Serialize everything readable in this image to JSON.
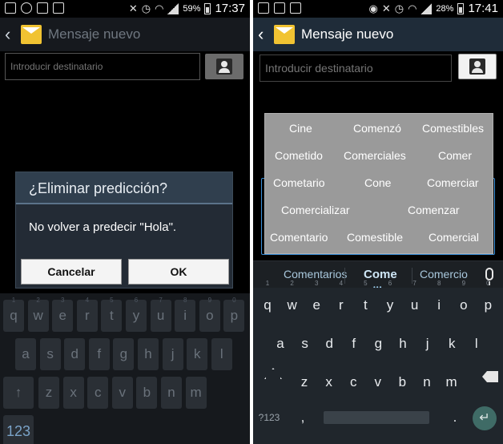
{
  "left": {
    "status": {
      "battery": "59%",
      "time": "17:37"
    },
    "header": {
      "title": "Mensaje nuevo"
    },
    "recipient": {
      "placeholder": "Introducir destinatario"
    },
    "dialog": {
      "title": "¿Eliminar predicción?",
      "message": "No volver a predecir \"Hola\".",
      "cancel_label": "Cancelar",
      "ok_label": "OK"
    },
    "keyboard": {
      "row1": [
        "q",
        "w",
        "e",
        "r",
        "t",
        "y",
        "u",
        "i",
        "o",
        "p"
      ],
      "row1_sub": [
        "1",
        "2",
        "3",
        "4",
        "5",
        "6",
        "7",
        "8",
        "9",
        "0"
      ],
      "row2": [
        "a",
        "s",
        "d",
        "f",
        "g",
        "h",
        "j",
        "k",
        "l"
      ],
      "row3": [
        "z",
        "x",
        "c",
        "v",
        "b",
        "n",
        "m"
      ],
      "symbols_label": "123"
    }
  },
  "right": {
    "status": {
      "battery": "28%",
      "time": "17:41"
    },
    "header": {
      "title": "Mensaje nuevo"
    },
    "recipient": {
      "placeholder": "Introducir destinatario"
    },
    "suggestions": [
      "Cine",
      "Comenzó",
      "Comestibles",
      "Cometido",
      "Comerciales",
      "Comer",
      "Cometario",
      "Cone",
      "Comerciar",
      "Comercializar",
      "Comenzar",
      "Comentario",
      "Comestible",
      "Comercial"
    ],
    "strip": [
      "Comentarios",
      "Come",
      "Comercio"
    ],
    "keyboard": {
      "row1": [
        "q",
        "w",
        "e",
        "r",
        "t",
        "y",
        "u",
        "i",
        "o",
        "p"
      ],
      "row1_sub": [
        "1",
        "2",
        "3",
        "4",
        "5",
        "6",
        "7",
        "8",
        "9",
        "0"
      ],
      "row2": [
        "a",
        "s",
        "d",
        "f",
        "g",
        "h",
        "j",
        "k",
        "l"
      ],
      "row3": [
        "z",
        "x",
        "c",
        "v",
        "b",
        "n",
        "m"
      ],
      "symbols_label": "?123",
      "comma": ",",
      "period": "."
    }
  }
}
